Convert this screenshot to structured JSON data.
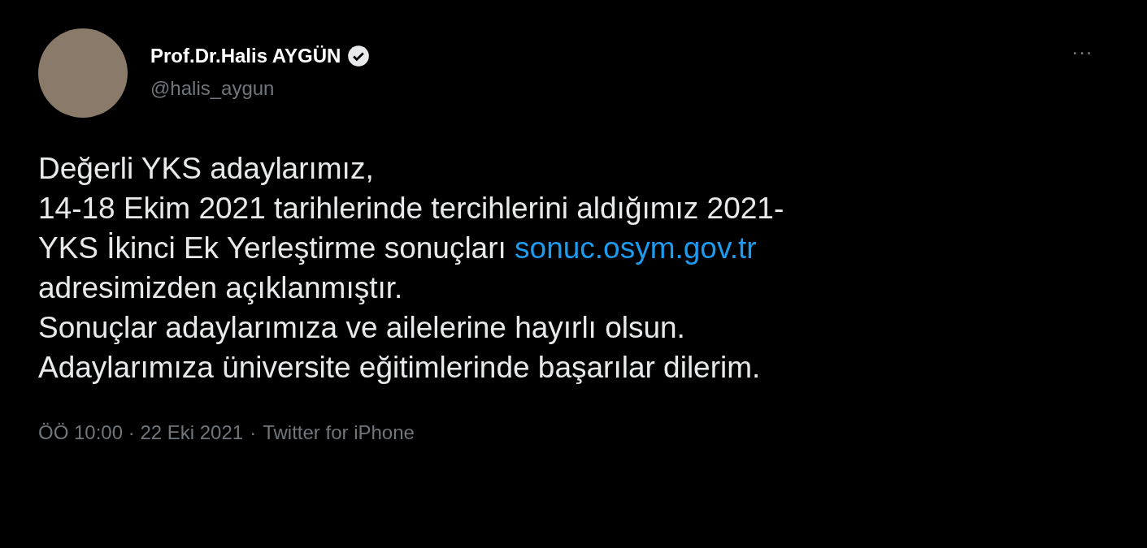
{
  "author": {
    "name": "Prof.Dr.Halis AYGÜN",
    "verified": true,
    "handle": "@halis_aygun"
  },
  "more": "···",
  "body": {
    "before": "Değerli YKS adaylarımız,\n14-18 Ekim 2021 tarihlerinde tercihlerini aldığımız 2021-\nYKS İkinci Ek Yerleştirme sonuçları ",
    "link": "sonuc.osym.gov.tr",
    "after": "\nadresimizden açıklanmıştır.\nSonuçlar adaylarımıza ve ailelerine hayırlı olsun.\nAdaylarımıza üniversite eğitimlerinde başarılar dilerim."
  },
  "footer": {
    "time_date": "ÖÖ 10:00 · 22 Eki 2021",
    "separator": "·",
    "source": "Twitter for iPhone"
  }
}
